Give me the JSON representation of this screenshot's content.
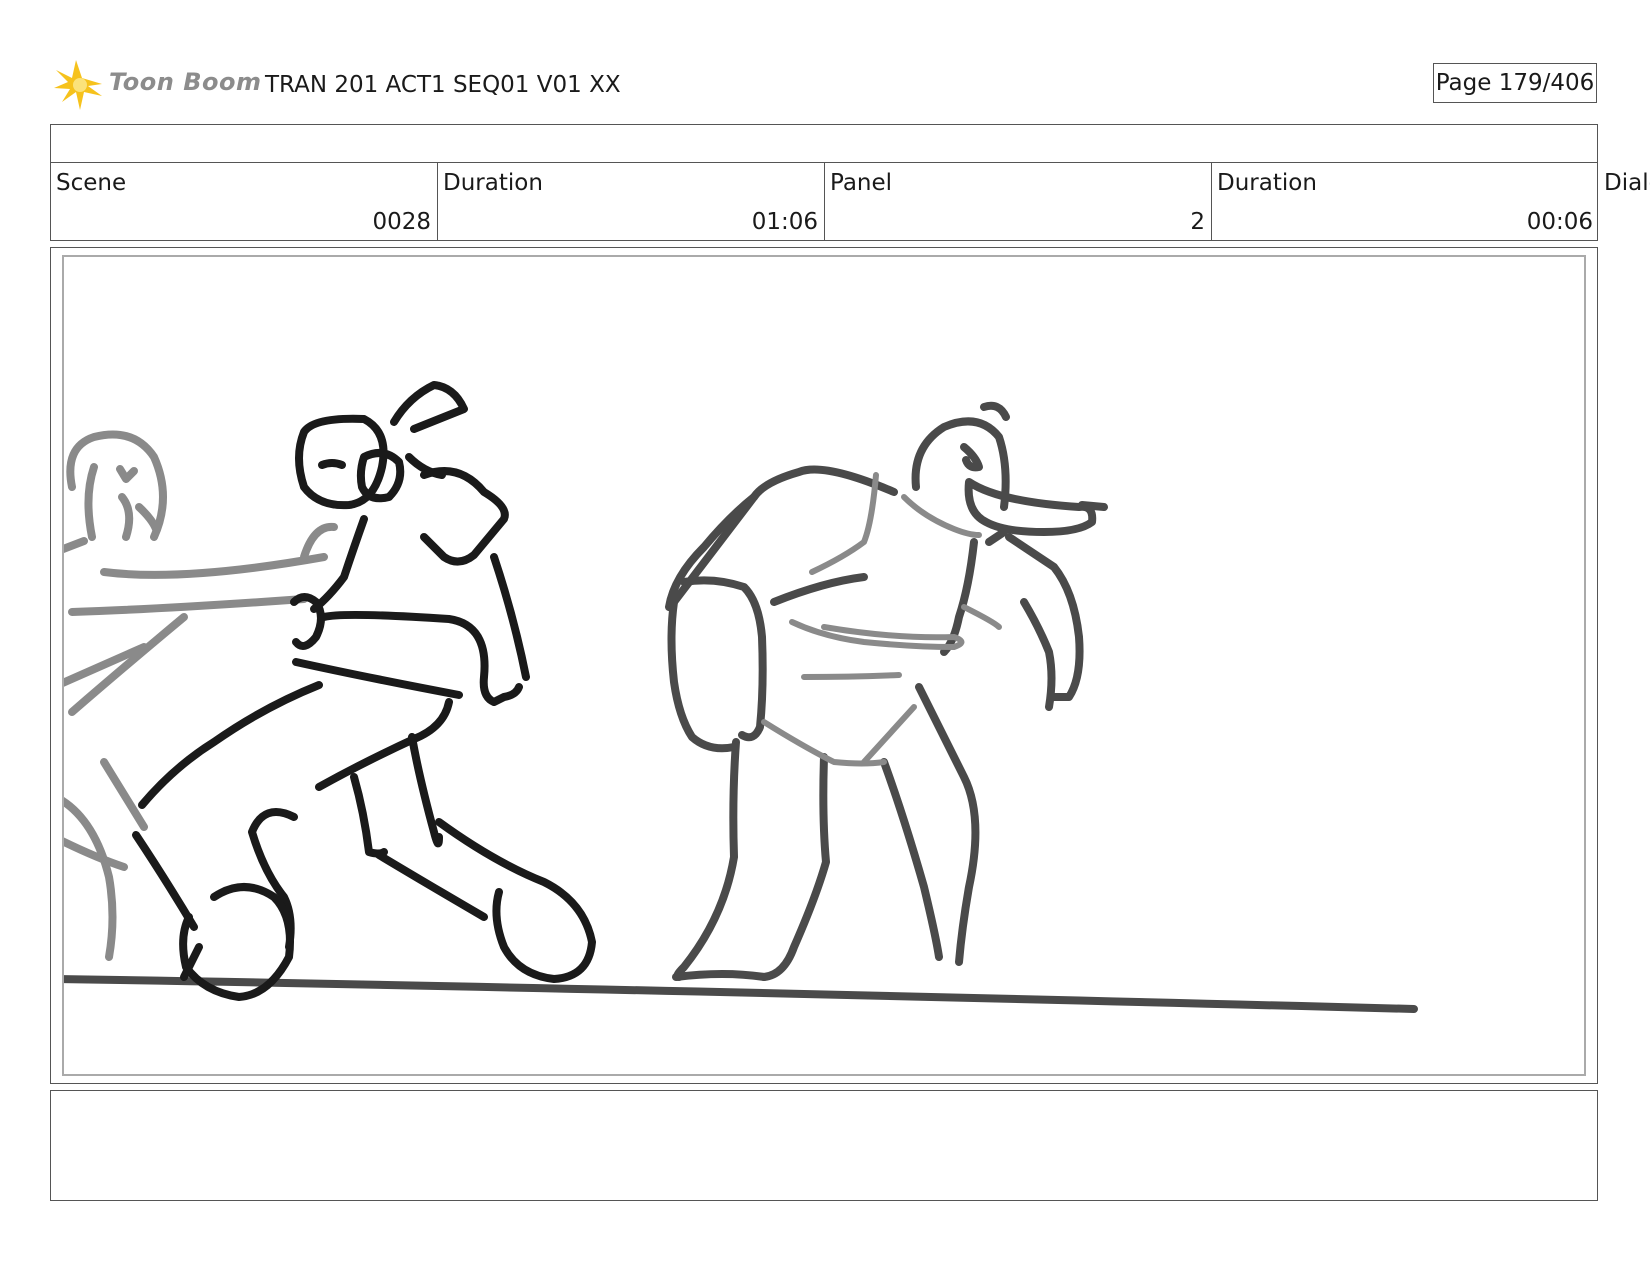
{
  "header": {
    "logo_text": "Toon Boom",
    "project_title": "TRAN 201 ACT1 SEQ01 V01 XX",
    "page_label": "Page 179/406"
  },
  "info": {
    "scene": {
      "label": "Scene",
      "value": "0028"
    },
    "scene_duration": {
      "label": "Duration",
      "value": "01:06"
    },
    "panel": {
      "label": "Panel",
      "value": "2"
    },
    "panel_duration": {
      "label": "Duration",
      "value": "00:06"
    },
    "dialog_label": "Dialo"
  },
  "notes": {
    "text": ""
  },
  "colors": {
    "logo_yellow": "#f6c21c",
    "logo_text": "#8c8c8c",
    "border": "#555555",
    "inner_frame": "#aaaaaa",
    "ink_dark": "#1a1a1a",
    "ink_mid": "#4a4a4a",
    "ink_light": "#8a8a8a"
  }
}
